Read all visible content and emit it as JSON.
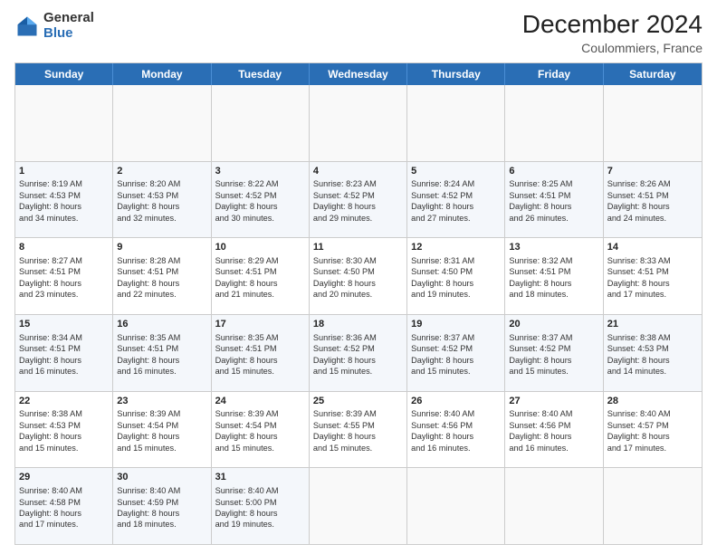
{
  "header": {
    "logo_general": "General",
    "logo_blue": "Blue",
    "main_title": "December 2024",
    "subtitle": "Coulommiers, France"
  },
  "calendar": {
    "days_of_week": [
      "Sunday",
      "Monday",
      "Tuesday",
      "Wednesday",
      "Thursday",
      "Friday",
      "Saturday"
    ],
    "weeks": [
      [
        {
          "day": "",
          "empty": true
        },
        {
          "day": "",
          "empty": true
        },
        {
          "day": "",
          "empty": true
        },
        {
          "day": "",
          "empty": true
        },
        {
          "day": "",
          "empty": true
        },
        {
          "day": "",
          "empty": true
        },
        {
          "day": "",
          "empty": true
        }
      ],
      [
        {
          "day": "1",
          "info": "Sunrise: 8:19 AM\nSunset: 4:53 PM\nDaylight: 8 hours\nand 34 minutes."
        },
        {
          "day": "2",
          "info": "Sunrise: 8:20 AM\nSunset: 4:53 PM\nDaylight: 8 hours\nand 32 minutes."
        },
        {
          "day": "3",
          "info": "Sunrise: 8:22 AM\nSunset: 4:52 PM\nDaylight: 8 hours\nand 30 minutes."
        },
        {
          "day": "4",
          "info": "Sunrise: 8:23 AM\nSunset: 4:52 PM\nDaylight: 8 hours\nand 29 minutes."
        },
        {
          "day": "5",
          "info": "Sunrise: 8:24 AM\nSunset: 4:52 PM\nDaylight: 8 hours\nand 27 minutes."
        },
        {
          "day": "6",
          "info": "Sunrise: 8:25 AM\nSunset: 4:51 PM\nDaylight: 8 hours\nand 26 minutes."
        },
        {
          "day": "7",
          "info": "Sunrise: 8:26 AM\nSunset: 4:51 PM\nDaylight: 8 hours\nand 24 minutes."
        }
      ],
      [
        {
          "day": "8",
          "info": "Sunrise: 8:27 AM\nSunset: 4:51 PM\nDaylight: 8 hours\nand 23 minutes."
        },
        {
          "day": "9",
          "info": "Sunrise: 8:28 AM\nSunset: 4:51 PM\nDaylight: 8 hours\nand 22 minutes."
        },
        {
          "day": "10",
          "info": "Sunrise: 8:29 AM\nSunset: 4:51 PM\nDaylight: 8 hours\nand 21 minutes."
        },
        {
          "day": "11",
          "info": "Sunrise: 8:30 AM\nSunset: 4:50 PM\nDaylight: 8 hours\nand 20 minutes."
        },
        {
          "day": "12",
          "info": "Sunrise: 8:31 AM\nSunset: 4:50 PM\nDaylight: 8 hours\nand 19 minutes."
        },
        {
          "day": "13",
          "info": "Sunrise: 8:32 AM\nSunset: 4:51 PM\nDaylight: 8 hours\nand 18 minutes."
        },
        {
          "day": "14",
          "info": "Sunrise: 8:33 AM\nSunset: 4:51 PM\nDaylight: 8 hours\nand 17 minutes."
        }
      ],
      [
        {
          "day": "15",
          "info": "Sunrise: 8:34 AM\nSunset: 4:51 PM\nDaylight: 8 hours\nand 16 minutes."
        },
        {
          "day": "16",
          "info": "Sunrise: 8:35 AM\nSunset: 4:51 PM\nDaylight: 8 hours\nand 16 minutes."
        },
        {
          "day": "17",
          "info": "Sunrise: 8:35 AM\nSunset: 4:51 PM\nDaylight: 8 hours\nand 15 minutes."
        },
        {
          "day": "18",
          "info": "Sunrise: 8:36 AM\nSunset: 4:52 PM\nDaylight: 8 hours\nand 15 minutes."
        },
        {
          "day": "19",
          "info": "Sunrise: 8:37 AM\nSunset: 4:52 PM\nDaylight: 8 hours\nand 15 minutes."
        },
        {
          "day": "20",
          "info": "Sunrise: 8:37 AM\nSunset: 4:52 PM\nDaylight: 8 hours\nand 15 minutes."
        },
        {
          "day": "21",
          "info": "Sunrise: 8:38 AM\nSunset: 4:53 PM\nDaylight: 8 hours\nand 14 minutes."
        }
      ],
      [
        {
          "day": "22",
          "info": "Sunrise: 8:38 AM\nSunset: 4:53 PM\nDaylight: 8 hours\nand 15 minutes."
        },
        {
          "day": "23",
          "info": "Sunrise: 8:39 AM\nSunset: 4:54 PM\nDaylight: 8 hours\nand 15 minutes."
        },
        {
          "day": "24",
          "info": "Sunrise: 8:39 AM\nSunset: 4:54 PM\nDaylight: 8 hours\nand 15 minutes."
        },
        {
          "day": "25",
          "info": "Sunrise: 8:39 AM\nSunset: 4:55 PM\nDaylight: 8 hours\nand 15 minutes."
        },
        {
          "day": "26",
          "info": "Sunrise: 8:40 AM\nSunset: 4:56 PM\nDaylight: 8 hours\nand 16 minutes."
        },
        {
          "day": "27",
          "info": "Sunrise: 8:40 AM\nSunset: 4:56 PM\nDaylight: 8 hours\nand 16 minutes."
        },
        {
          "day": "28",
          "info": "Sunrise: 8:40 AM\nSunset: 4:57 PM\nDaylight: 8 hours\nand 17 minutes."
        }
      ],
      [
        {
          "day": "29",
          "info": "Sunrise: 8:40 AM\nSunset: 4:58 PM\nDaylight: 8 hours\nand 17 minutes."
        },
        {
          "day": "30",
          "info": "Sunrise: 8:40 AM\nSunset: 4:59 PM\nDaylight: 8 hours\nand 18 minutes."
        },
        {
          "day": "31",
          "info": "Sunrise: 8:40 AM\nSunset: 5:00 PM\nDaylight: 8 hours\nand 19 minutes."
        },
        {
          "day": "",
          "empty": true
        },
        {
          "day": "",
          "empty": true
        },
        {
          "day": "",
          "empty": true
        },
        {
          "day": "",
          "empty": true
        }
      ]
    ]
  }
}
